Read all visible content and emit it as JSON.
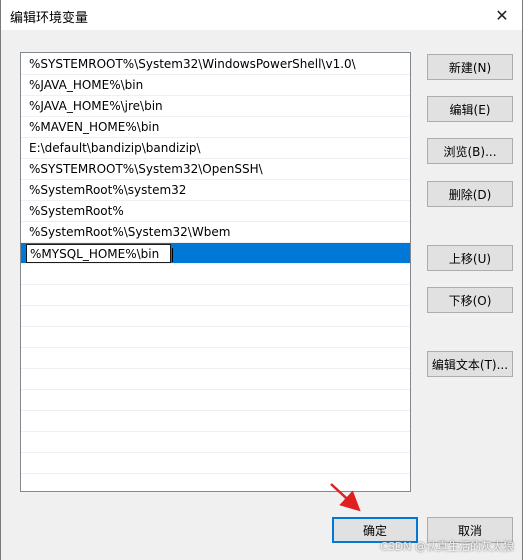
{
  "window": {
    "title": "编辑环境变量",
    "close_glyph": "✕"
  },
  "list": {
    "items": [
      "%SYSTEMROOT%\\System32\\WindowsPowerShell\\v1.0\\",
      "%JAVA_HOME%\\bin",
      "%JAVA_HOME%\\jre\\bin",
      "%MAVEN_HOME%\\bin",
      "E:\\default\\bandizip\\bandizip\\",
      "%SYSTEMROOT%\\System32\\OpenSSH\\",
      "%SystemRoot%\\system32",
      "%SystemRoot%",
      "%SystemRoot%\\System32\\Wbem"
    ],
    "editing_value": "%MYSQL_HOME%\\bin"
  },
  "buttons": {
    "new": "新建(N)",
    "edit": "编辑(E)",
    "browse": "浏览(B)...",
    "delete": "删除(D)",
    "move_up": "上移(U)",
    "move_down": "下移(O)",
    "edit_text": "编辑文本(T)...",
    "ok": "确定",
    "cancel": "取消"
  },
  "watermark": "CSDN @认真生活的灰太狼",
  "colors": {
    "selection": "#0078d7",
    "arrow": "#e02020"
  }
}
